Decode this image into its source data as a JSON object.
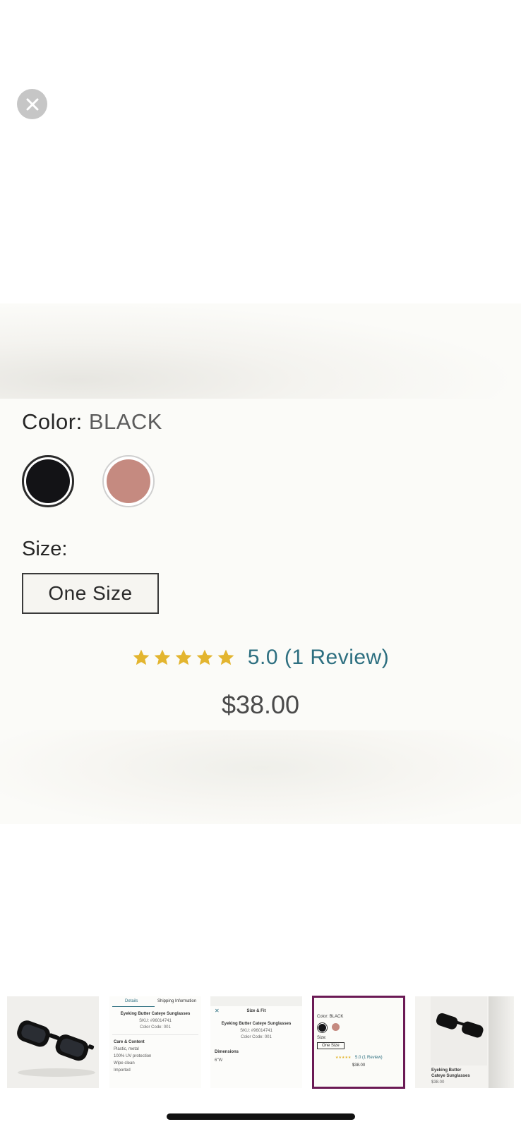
{
  "close": {
    "icon": "close-icon"
  },
  "product": {
    "color_key": "Color:",
    "color_value": "BLACK",
    "swatches": [
      {
        "name": "black",
        "color": "#131316"
      },
      {
        "name": "pink",
        "color": "#c58a80"
      }
    ],
    "size_key": "Size:",
    "size_option": "One Size",
    "rating_value": "5.0 (1 Review)",
    "stars": 5,
    "price": "$38.00"
  },
  "thumbs": {
    "t2": {
      "tab_details": "Details",
      "tab_shipping": "Shipping Information",
      "title": "Eyeking Butter Cateye Sunglasses",
      "sku": "SKU: #96014741",
      "color_code": "Color Code: 001",
      "care_heading": "Care & Content",
      "care_lines": [
        "Plastic, metal",
        "100% UV protection",
        "Wipe clean",
        "Imported"
      ]
    },
    "t3": {
      "heading": "Size & Fit",
      "title": "Eyeking Butter Cateye Sunglasses",
      "sku": "SKU: #96014741",
      "color_code": "Color Code: 001",
      "dimensions_heading": "Dimensions",
      "dimensions_value": "6\"W"
    },
    "t4": {
      "color_line": "Color: BLACK",
      "size_key": "Size:",
      "size_option": "One Size",
      "rating": "5.0 (1 Review)",
      "price": "$38.00"
    },
    "t5": {
      "title_line1": "Eyeking Butter",
      "title_line2": "Cateye Sunglasses",
      "price": "$38.00"
    }
  },
  "colors": {
    "accent_teal": "#2d6f80",
    "star": "#e3b52f",
    "selected_border": "#6b1a55"
  }
}
